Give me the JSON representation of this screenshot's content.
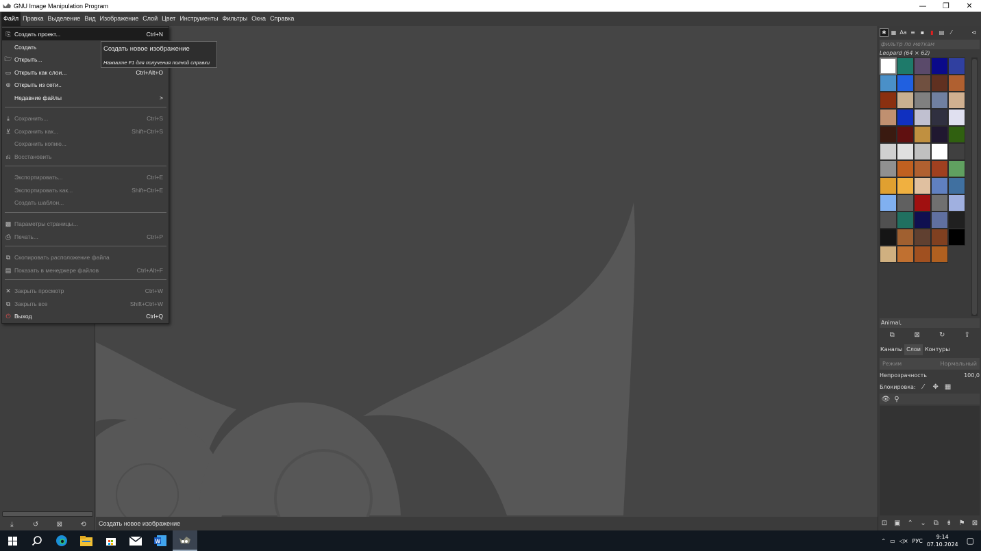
{
  "window": {
    "title": "GNU Image Manipulation Program"
  },
  "menubar": [
    "Файл",
    "Правка",
    "Выделение",
    "Вид",
    "Изображение",
    "Слой",
    "Цвет",
    "Инструменты",
    "Фильтры",
    "Окна",
    "Справка"
  ],
  "file_menu": {
    "items": [
      {
        "label": "Создать проект...",
        "shortcut": "Ctrl+N",
        "icon": "new-project-icon",
        "state": "highlighted"
      },
      {
        "label": "Создать",
        "shortcut": "",
        "icon": "",
        "state": "enabled"
      },
      {
        "label": "Открыть...",
        "shortcut": "",
        "icon": "open-icon",
        "state": "enabled"
      },
      {
        "label": "Открыть как слои...",
        "shortcut": "Ctrl+Alt+O",
        "icon": "open-layers-icon",
        "state": "enabled"
      },
      {
        "label": "Открыть из сети..",
        "shortcut": "",
        "icon": "globe-icon",
        "state": "enabled"
      },
      {
        "label": "Недавние файлы",
        "shortcut": ">",
        "icon": "",
        "state": "enabled"
      },
      {
        "label": "Сохранить...",
        "shortcut": "Ctrl+S",
        "icon": "save-icon",
        "state": "disabled"
      },
      {
        "label": "Сохранить как...",
        "shortcut": "Shift+Ctrl+S",
        "icon": "save-as-icon",
        "state": "disabled"
      },
      {
        "label": "Сохранить копию...",
        "shortcut": "",
        "icon": "",
        "state": "disabled"
      },
      {
        "label": "Восстановить",
        "shortcut": "",
        "icon": "revert-icon",
        "state": "disabled"
      },
      {
        "label": "Экспортировать...",
        "shortcut": "Ctrl+E",
        "icon": "",
        "state": "disabled"
      },
      {
        "label": "Экспортировать как...",
        "shortcut": "Shift+Ctrl+E",
        "icon": "",
        "state": "disabled"
      },
      {
        "label": "Создать шаблон...",
        "shortcut": "",
        "icon": "",
        "state": "disabled"
      },
      {
        "label": "Параметры страницы...",
        "shortcut": "",
        "icon": "page-setup-icon",
        "state": "disabled"
      },
      {
        "label": "Печать...",
        "shortcut": "Ctrl+P",
        "icon": "print-icon",
        "state": "disabled"
      },
      {
        "label": "Скопировать расположение файла",
        "shortcut": "",
        "icon": "copy-location-icon",
        "state": "disabled"
      },
      {
        "label": "Показать в менеджере файлов",
        "shortcut": "Ctrl+Alt+F",
        "icon": "file-manager-icon",
        "state": "disabled"
      },
      {
        "label": "Закрыть просмотр",
        "shortcut": "Ctrl+W",
        "icon": "close-icon",
        "state": "disabled"
      },
      {
        "label": "Закрыть все",
        "shortcut": "Shift+Ctrl+W",
        "icon": "close-all-icon",
        "state": "disabled"
      },
      {
        "label": "Выход",
        "shortcut": "Ctrl+Q",
        "icon": "quit-icon",
        "state": "enabled"
      }
    ]
  },
  "tooltip": {
    "title": "Создать новое изображение",
    "hint": "Нажмите F1 для получения полной справки"
  },
  "statusbar": {
    "text": "Создать новое изображение"
  },
  "patterns": {
    "filter_placeholder": "фильтр по меткам",
    "selected_name": "Leopard (64 × 62)",
    "tag_field": "Animal,",
    "swatch_colors": [
      "#ffffff",
      "#1e7a6a",
      "#5a4a6a",
      "#0a0a8a",
      "#3040a0",
      "#4a90c8",
      "#2060e0",
      "#705040",
      "#603020",
      "#b06030",
      "#8a3010",
      "#c8b090",
      "#808080",
      "#7080a0",
      "#d0b090",
      "#c09070",
      "#1030c0",
      "#c0c0d0",
      "#303040",
      "#e0e0f0",
      "#3a1a10",
      "#601010",
      "#c09040",
      "#201830",
      "#306010",
      "#d0d0d0",
      "#e0e0e0",
      "#c0c0c0",
      "#ffffff",
      "#404040",
      "#909090",
      "#c06020",
      "#b06030",
      "#a04020",
      "#60a060",
      "#e0a030",
      "#f0b040",
      "#e0c0a0",
      "#6080c0",
      "#4070a0",
      "#80b0f0",
      "#606060",
      "#a01010",
      "#707070",
      "#a0b0e0",
      "#505050",
      "#207060",
      "#101050",
      "#6070a0",
      "#202020",
      "#151515",
      "#a06030",
      "#604030",
      "#804020",
      "#000000",
      "#d0b080",
      "#c07030",
      "#a05020",
      "#b06020"
    ]
  },
  "dock_tabs": [
    "Каналы",
    "Слои",
    "Контуры"
  ],
  "layers": {
    "mode_label": "Режим",
    "mode_value": "Нормальный",
    "opacity_label": "Непрозрачность",
    "opacity_value": "100,0",
    "lock_label": "Блокировка:"
  },
  "taskbar": {
    "lang": "РУС",
    "time": "9:14",
    "date": "07.10.2024"
  }
}
